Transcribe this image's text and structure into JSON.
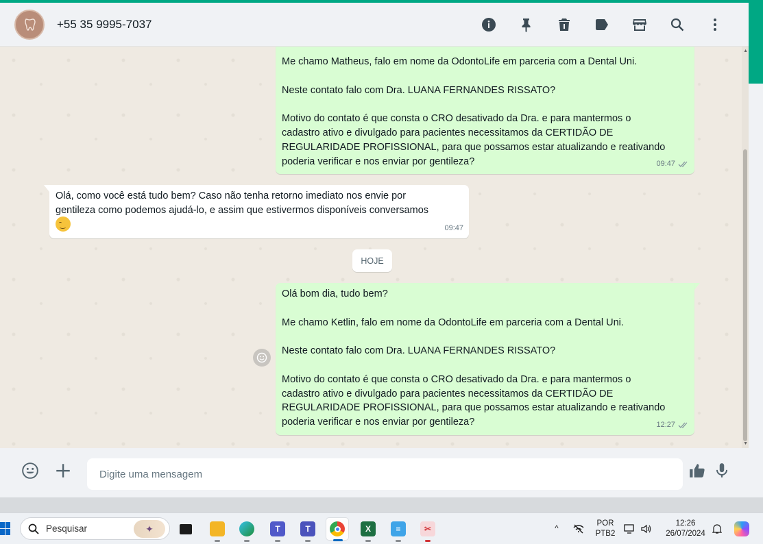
{
  "header": {
    "contact_name": "+55 35 9995-7037",
    "icons": [
      "info-icon",
      "pin-icon",
      "delete-icon",
      "label-icon",
      "catalog-store-icon",
      "search-icon",
      "menu-icon"
    ]
  },
  "messages": [
    {
      "direction": "outgoing",
      "lines": [
        "Me chamo Matheus, falo em nome da OdontoLife em parceria com a Dental Uni.",
        "",
        "Neste contato falo com Dra. LUANA FERNANDES RISSATO?",
        "",
        "Motivo do contato é que consta o CRO desativado da Dra. e para mantermos o",
        "cadastro ativo e divulgado para pacientes necessitamos da CERTIDÃO DE",
        "REGULARIDADE PROFISSIONAL, para que possamos estar atualizando e reativando",
        "poderia verificar e nos enviar por gentileza?"
      ],
      "time": "09:47",
      "status": "read"
    },
    {
      "direction": "incoming",
      "lines": [
        "Olá, como você está tudo bem? Caso não tenha retorno imediato nos envie por",
        "gentileza como podemos ajudá-lo, e assim que estivermos disponíveis conversamos"
      ],
      "emoji": "relieved-face-emoji",
      "time": "09:47"
    },
    {
      "direction": "outgoing",
      "lines": [
        "Olá bom dia, tudo bem?",
        "",
        "Me chamo Ketlin, falo em nome da OdontoLife em parceria com a Dental Uni.",
        "",
        "Neste contato falo com Dra. LUANA FERNANDES RISSATO?",
        "",
        "Motivo do contato é que consta o CRO desativado da Dra. e para mantermos o",
        "cadastro ativo e divulgado para pacientes necessitamos da CERTIDÃO DE",
        "REGULARIDADE PROFISSIONAL, para que possamos estar atualizando e reativando",
        "poderia verificar e nos enviar por gentileza?"
      ],
      "time": "12:27",
      "status": "read"
    }
  ],
  "day_divider": "HOJE",
  "composer": {
    "placeholder": "Digite uma mensagem",
    "icons": [
      "emoji-icon",
      "attach-plus-icon",
      "thumbs-up-icon",
      "microphone-icon"
    ]
  },
  "taskbar": {
    "search_label": "Pesquisar",
    "apps": [
      "task-view",
      "file-explorer",
      "edge",
      "teams",
      "teams-new",
      "chrome",
      "excel",
      "notepad",
      "snipping-tool"
    ],
    "active_app": "chrome",
    "language_top": "POR",
    "language_bottom": "PTB2",
    "time": "12:26",
    "date": "26/07/2024"
  }
}
